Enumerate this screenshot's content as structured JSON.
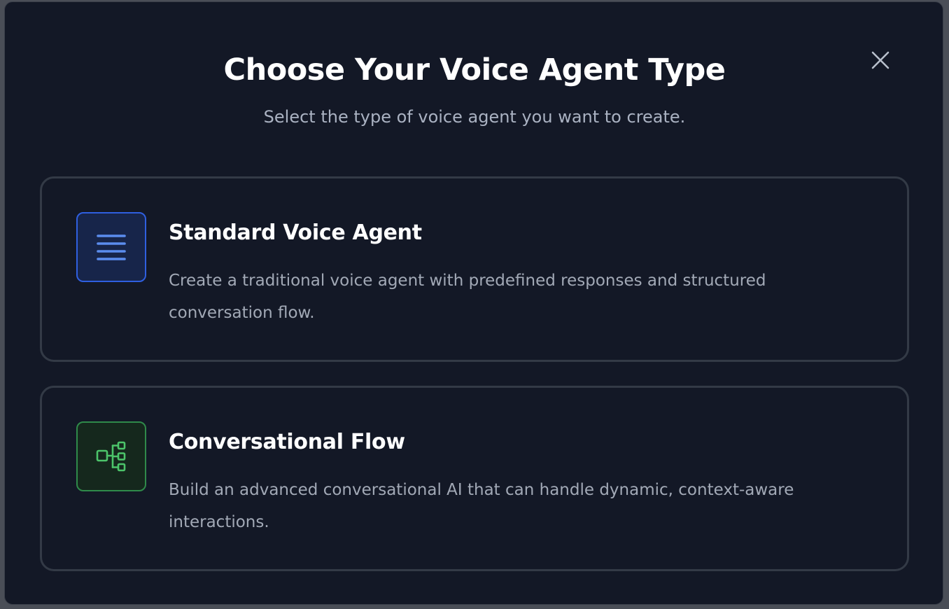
{
  "modal": {
    "title": "Choose Your Voice Agent Type",
    "subtitle": "Select the type of voice agent you want to create.",
    "close_icon": "close-icon"
  },
  "options": [
    {
      "title": "Standard Voice Agent",
      "description": "Create a traditional voice agent with predefined responses and structured conversation flow.",
      "icon": "lines-icon",
      "accent": "#5b8def"
    },
    {
      "title": "Conversational Flow",
      "description": "Build an advanced conversational AI that can handle dynamic, context-aware interactions.",
      "icon": "flow-tree-icon",
      "accent": "#4cc46a"
    }
  ]
}
